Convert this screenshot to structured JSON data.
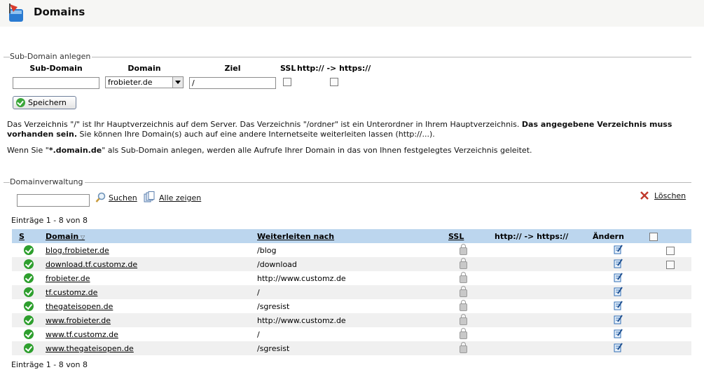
{
  "header": {
    "title": "Domains"
  },
  "subdomain_section": {
    "legend": "Sub-Domain anlegen",
    "col_subdomain": "Sub-Domain",
    "col_domain": "Domain",
    "col_ziel": "Ziel",
    "col_ssl": "SSL",
    "col_redirect": "http:// -> https://",
    "subdomain_value": "",
    "domain_selected": "frobieter.de",
    "ziel_value": "/",
    "save_label": "Speichern",
    "info1_part1": "Das Verzeichnis \"/\" ist Ihr Hauptverzeichnis auf dem Server. Das Verzeichnis \"/ordner\" ist ein Unterordner in Ihrem Hauptverzeichnis. ",
    "info1_bold": "Das angegebene Verzeichnis muss vorhanden sein.",
    "info1_part2": " Sie können Ihre Domain(s) auch auf eine andere Internetseite weiterleiten lassen (http://...).",
    "info2_part1": "Wenn Sie \"",
    "info2_bold": "*.domain.de",
    "info2_part2": "\" als Sub-Domain anlegen, werden alle Aufrufe Ihrer Domain in das von Ihnen festgelegtes Verzeichnis geleitet."
  },
  "management_section": {
    "legend": "Domainverwaltung",
    "search_value": "",
    "search_label": "Suchen",
    "show_all_label": "Alle zeigen",
    "delete_label": "Löschen",
    "entries_top": "Einträge 1 - 8 von 8",
    "entries_bottom": "Einträge 1 - 8 von 8"
  },
  "table": {
    "headers": {
      "s": "S",
      "domain": "Domain",
      "redirect_target": "Weiterleiten nach",
      "ssl": "SSL",
      "https": "http:// -> https://",
      "edit": "Ändern"
    },
    "rows": [
      {
        "domain": "blog.frobieter.de",
        "target": "/blog",
        "deletable": true
      },
      {
        "domain": "download.tf.customz.de",
        "target": "/download",
        "deletable": true
      },
      {
        "domain": "frobieter.de",
        "target": "http://www.customz.de",
        "deletable": false
      },
      {
        "domain": "tf.customz.de",
        "target": "/",
        "deletable": false
      },
      {
        "domain": "thegateisopen.de",
        "target": "/sgresist",
        "deletable": false
      },
      {
        "domain": "www.frobieter.de",
        "target": "http://www.customz.de",
        "deletable": false
      },
      {
        "domain": "www.tf.customz.de",
        "target": "/",
        "deletable": false
      },
      {
        "domain": "www.thegateisopen.de",
        "target": "/sgresist",
        "deletable": false
      }
    ]
  },
  "colors": {
    "table_header": "#bcd6ee",
    "row_alt": "#f0f0f0",
    "status_ok": "#2e9f2e",
    "delete_x": "#c0392b"
  }
}
